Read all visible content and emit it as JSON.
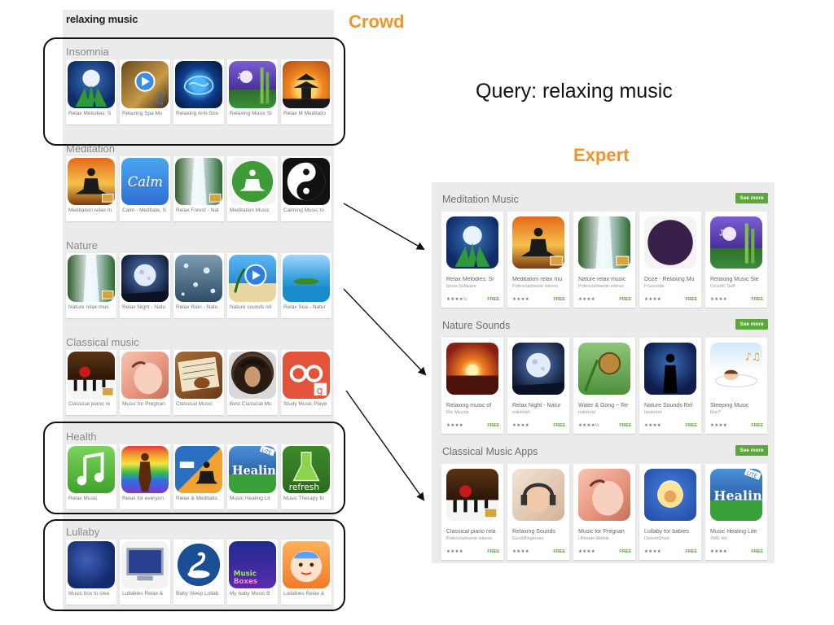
{
  "crowd": {
    "query": "relaxing music",
    "sections": [
      {
        "title": "Insomnia",
        "apps": [
          {
            "name": "Relax Melodies: S",
            "icon": "moon-lotus-icon",
            "theme": "g-moon"
          },
          {
            "name": "Relaxing Spa Mu",
            "icon": "spa-play-icon",
            "theme": "g-spa"
          },
          {
            "name": "Relaxing Anti-Stre",
            "icon": "glowing-brain-icon",
            "theme": "g-brain"
          },
          {
            "name": "Relaxing Music Sl",
            "icon": "bamboo-moon-icon",
            "theme": "g-bamboo"
          },
          {
            "name": "Relax M Meditatio",
            "icon": "pagoda-sunset-icon",
            "theme": "g-pagoda"
          }
        ]
      },
      {
        "title": "Meditation",
        "apps": [
          {
            "name": "Meditation relax m",
            "icon": "meditating-silhouette-icon",
            "theme": "g-sunset-yoga"
          },
          {
            "name": "Calm - Meditate, S",
            "icon": "calm-logo-icon",
            "theme": "g-calm"
          },
          {
            "name": "Relax Forest - Nat",
            "icon": "waterfall-icon",
            "theme": "g-waterfall"
          },
          {
            "name": "Meditation Music",
            "icon": "meditation-figure-icon",
            "theme": "g-green-circle"
          },
          {
            "name": "Calming Music to",
            "icon": "yin-yang-icon",
            "theme": "g-yinyang"
          }
        ]
      },
      {
        "title": "Nature",
        "apps": [
          {
            "name": "Nature relax mus",
            "icon": "waterfall-icon",
            "theme": "g-waterfall"
          },
          {
            "name": "Relax Night - Natu",
            "icon": "night-moon-icon",
            "theme": "g-nightmoon"
          },
          {
            "name": "Relax Rain - Natu",
            "icon": "raindrops-icon",
            "theme": "g-rain"
          },
          {
            "name": "Nature sounds rel",
            "icon": "beach-play-icon",
            "theme": "g-beach"
          },
          {
            "name": "Relax Sea - Natur",
            "icon": "island-sea-icon",
            "theme": "g-sea"
          }
        ]
      },
      {
        "title": "Classical music",
        "apps": [
          {
            "name": "Classical piano re",
            "icon": "piano-rose-icon",
            "theme": "g-piano"
          },
          {
            "name": "Music for Pregnan",
            "icon": "pregnant-belly-icon",
            "theme": "g-pregnancy"
          },
          {
            "name": "Classical Music",
            "icon": "violin-sheet-icon",
            "theme": "g-classical"
          },
          {
            "name": "Best Classical Mu",
            "icon": "beethoven-portrait-icon",
            "theme": "g-beethoven"
          },
          {
            "name": "Study Music Playe",
            "icon": "glasses-note-icon",
            "theme": "g-study"
          }
        ]
      },
      {
        "title": "Health",
        "apps": [
          {
            "name": "Relax Music",
            "icon": "music-note-icon",
            "theme": "g-music-note"
          },
          {
            "name": "Relax for everyon",
            "icon": "rainbow-body-icon",
            "theme": "g-rainbow"
          },
          {
            "name": "Relax & Meditatio",
            "icon": "bed-meditation-icon",
            "theme": "g-relax-med"
          },
          {
            "name": "Music Healing Lit",
            "icon": "healing-lite-icon",
            "theme": "g-healing"
          },
          {
            "name": "Music Therapy fo",
            "icon": "refresh-flask-icon",
            "theme": "g-refresh"
          }
        ]
      },
      {
        "title": "Lullaby",
        "apps": [
          {
            "name": "Music box to slee",
            "icon": "crescent-moon-icon",
            "theme": "g-musicbox"
          },
          {
            "name": "Lullabies Relax &",
            "icon": "monitor-moon-icon",
            "theme": "g-lullabies-monitor"
          },
          {
            "name": "Baby Sleep Lullab",
            "icon": "swan-icon",
            "theme": "g-swan"
          },
          {
            "name": "My baby Music B",
            "icon": "music-boxes-icon",
            "theme": "g-mybaby"
          },
          {
            "name": "Lullabies Relax &",
            "icon": "baby-face-icon",
            "theme": "g-babyface"
          }
        ]
      }
    ]
  },
  "labels": {
    "crowd": "Crowd",
    "query": "Query: relaxing music",
    "expert": "Expert"
  },
  "expert": {
    "see_more": "See more",
    "sections": [
      {
        "title": "Meditation Music",
        "apps": [
          {
            "name": "Relax Melodies: Sl",
            "dev": "Ipnos Software",
            "stars": "★★★★½",
            "price": "FREE",
            "icon": "moon-lotus-icon",
            "theme": "g-moon"
          },
          {
            "name": "Meditation relax mu",
            "dev": "Potencialmente interes",
            "stars": "★★★★",
            "price": "FREE",
            "icon": "meditating-silhouette-icon",
            "theme": "g-sunset-yoga"
          },
          {
            "name": "Nature relax music",
            "dev": "Potencialmente interes",
            "stars": "★★★★",
            "price": "FREE",
            "icon": "waterfall-icon",
            "theme": "g-waterfall"
          },
          {
            "name": "Doze - Relaxing Mu",
            "dev": "Founcode",
            "stars": "★★★★",
            "price": "FREE",
            "icon": "crescent-circle-icon",
            "theme": "g-doze"
          },
          {
            "name": "Relaxing Music Sle",
            "dev": "Cicmilic Soft",
            "stars": "★★★★",
            "price": "FREE",
            "icon": "bamboo-moon-icon",
            "theme": "g-bamboo"
          }
        ]
      },
      {
        "title": "Nature Sounds",
        "apps": [
          {
            "name": "Relaxing music of",
            "dev": "Mix Mezcla",
            "stars": "★★★★",
            "price": "FREE",
            "icon": "sunset-sea-icon",
            "theme": "g-sunset-sea"
          },
          {
            "name": "Relax Night - Natur",
            "dev": "mikdroid",
            "stars": "★★★★",
            "price": "FREE",
            "icon": "night-moon-icon",
            "theme": "g-nightmoon"
          },
          {
            "name": "Water & Gong ~ Re",
            "dev": "mikdroid",
            "stars": "★★★★½",
            "price": "FREE",
            "icon": "water-gong-icon",
            "theme": "g-waterdrop"
          },
          {
            "name": "Nature Sounds Rel",
            "dev": "landerlot",
            "stars": "★★★★",
            "price": "FREE",
            "icon": "standing-silhouette-icon",
            "theme": "g-silhouette"
          },
          {
            "name": "Sleeping Music",
            "dev": "RonT",
            "stars": "★★★★",
            "price": "FREE",
            "icon": "sleeping-woman-icon",
            "theme": "g-sleep"
          }
        ]
      },
      {
        "title": "Classical Music Apps",
        "apps": [
          {
            "name": "Classical piano rela",
            "dev": "Potencialmente interes",
            "stars": "★★★★",
            "price": "FREE",
            "icon": "piano-rose-icon",
            "theme": "g-piano"
          },
          {
            "name": "Relaxing Sounds",
            "dev": "GoodRingtones",
            "stars": "★★★★",
            "price": "FREE",
            "icon": "headphones-woman-icon",
            "theme": "g-headphones"
          },
          {
            "name": "Music for Pregnan",
            "dev": "Ultimate Mobile",
            "stars": "★★★★",
            "price": "FREE",
            "icon": "pregnant-belly-icon",
            "theme": "g-pregnancy"
          },
          {
            "name": "Lullaby for babies",
            "dev": "DesemDroid",
            "stars": "★★★★",
            "price": "FREE",
            "icon": "baby-moon-icon",
            "theme": "g-babylullaby"
          },
          {
            "name": "Music Healing Lite",
            "dev": "XME Inc.",
            "stars": "★★★★",
            "price": "FREE",
            "icon": "healing-lite-icon",
            "theme": "g-healing"
          }
        ]
      }
    ]
  },
  "colors": {
    "accent_orange": "#f0942b",
    "see_more_green": "#5aa83a",
    "panel_gray": "#ebebeb"
  }
}
